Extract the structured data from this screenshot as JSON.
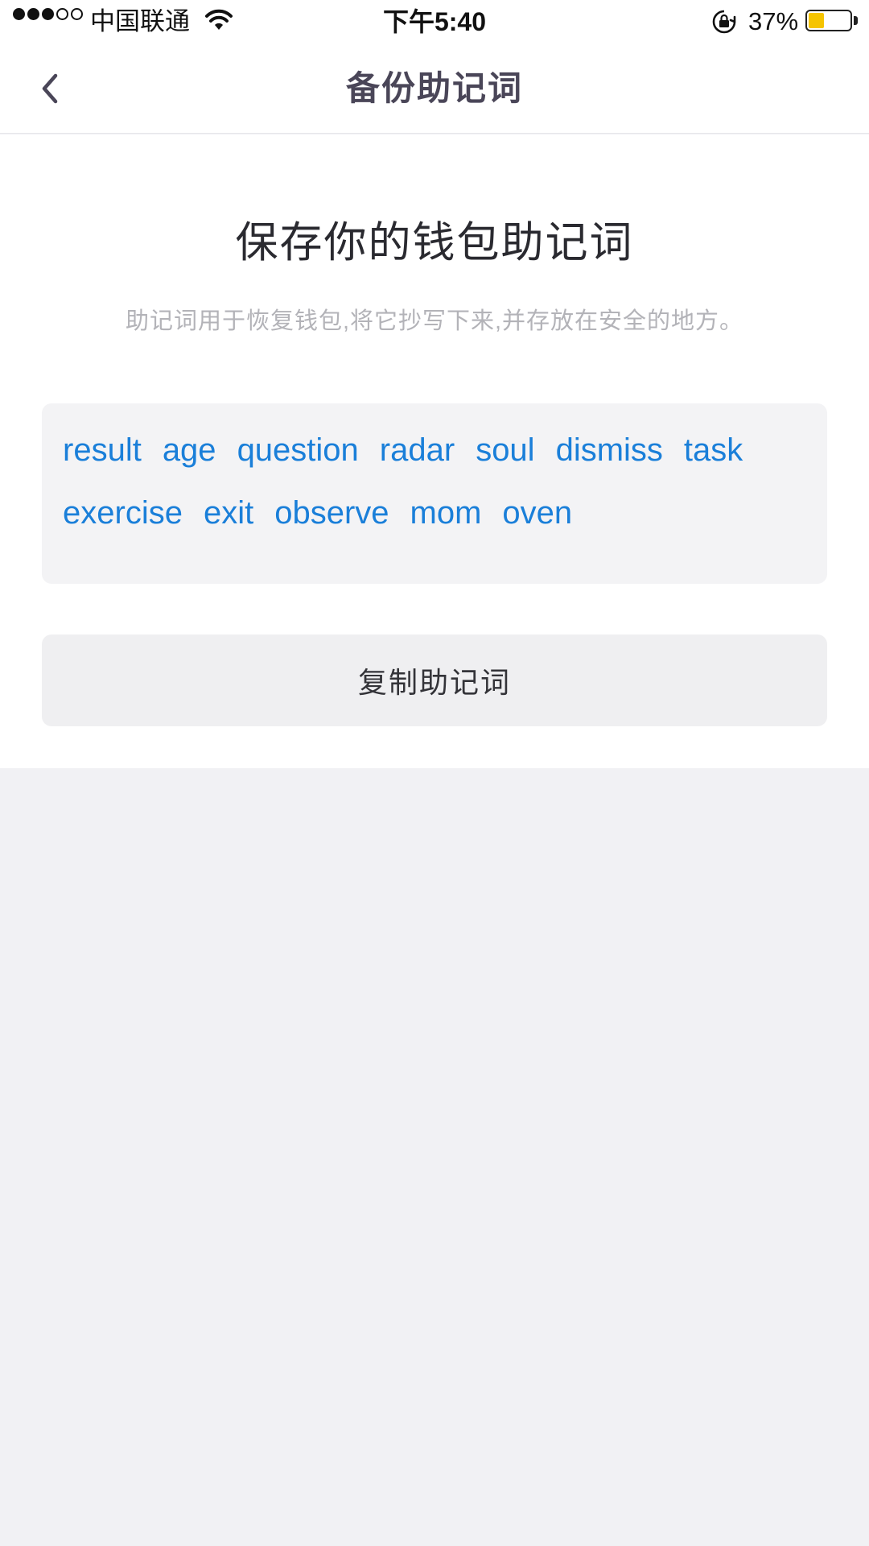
{
  "status_bar": {
    "signal_bars_filled": 3,
    "signal_bars_total": 5,
    "carrier": "中国联通",
    "wifi_icon": "wifi-icon",
    "time": "下午5:40",
    "orientation_lock_icon": "orientation-lock-icon",
    "battery_percent": "37%",
    "battery_level": 0.37,
    "battery_color": "#f5c400"
  },
  "nav": {
    "back_icon": "chevron-left-icon",
    "title": "备份助记词"
  },
  "main": {
    "headline": "保存你的钱包助记词",
    "subtitle": "助记词用于恢复钱包,将它抄写下来,并存放在安全的地方。",
    "mnemonic_words": [
      "result",
      "age",
      "question",
      "radar",
      "soul",
      "dismiss",
      "task",
      "exercise",
      "exit",
      "observe",
      "mom",
      "oven"
    ],
    "copy_button_label": "复制助记词"
  },
  "colors": {
    "word_accent": "#1a7fd9",
    "page_background": "#f1f1f4",
    "title_color": "#4a4658"
  }
}
